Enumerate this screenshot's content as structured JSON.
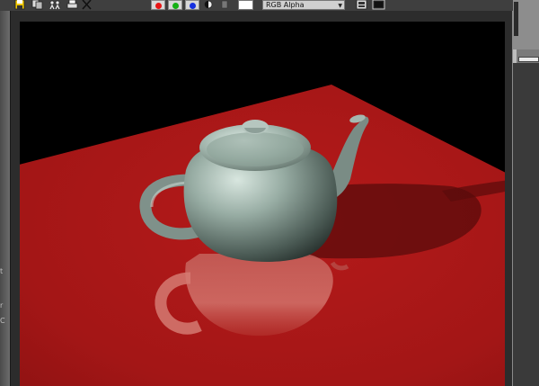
{
  "toolbar": {
    "icons": [
      "save-icon",
      "copy-icon",
      "clone-icon",
      "print-icon",
      "clear-icon"
    ],
    "channels": [
      {
        "name": "red-channel",
        "color": "#e81515"
      },
      {
        "name": "green-channel",
        "color": "#15b015"
      },
      {
        "name": "blue-channel",
        "color": "#1530e0"
      }
    ],
    "channel_select": "RGB Alpha",
    "swatch_color": "#ffffff"
  },
  "left_strip": {
    "chars": [
      "t",
      "r",
      "C"
    ]
  },
  "render": {
    "background": "#000000",
    "floor_color": "#a81818",
    "teapot_color": "#8fa39b",
    "subject": "teapot"
  }
}
